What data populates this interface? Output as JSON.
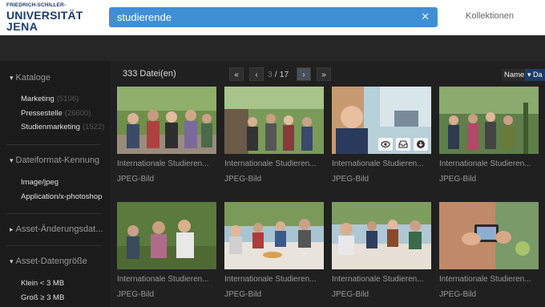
{
  "header": {
    "logo_line1": "FRIEDRICH-SCHILLER-",
    "logo_line2": "UNIVERSITÄT",
    "logo_line3": "JENA",
    "search_value": "studierende",
    "collections_label": "Kollektionen"
  },
  "sidebar": {
    "sections": [
      {
        "title": "Kataloge",
        "expanded": true,
        "items": [
          {
            "label": "Marketing",
            "count": "(5106)"
          },
          {
            "label": "Pressestelle",
            "count": "(26600)"
          },
          {
            "label": "Studienmarketing",
            "count": "(1522)"
          }
        ]
      },
      {
        "title": "Dateiformat-Kennung",
        "expanded": true,
        "items": [
          {
            "label": "Image/jpeg",
            "count": ""
          },
          {
            "label": "Application/x-photoshop",
            "count": ""
          }
        ]
      },
      {
        "title": "Asset-Änderungsdat...",
        "expanded": false,
        "items": []
      },
      {
        "title": "Asset-Datengröße",
        "expanded": true,
        "items": [
          {
            "label": "Klein < 3 MB",
            "count": ""
          },
          {
            "label": "Groß ≥ 3 MB",
            "count": ""
          }
        ]
      }
    ]
  },
  "results": {
    "count_label": "333 Datei(en)",
    "page_current": "3",
    "page_total": "/ 17",
    "sort_label": "Name",
    "sort_value": "Da"
  },
  "assets": [
    {
      "title": "Internationale Studieren...",
      "type": "JPEG-Bild"
    },
    {
      "title": "Internationale Studieren...",
      "type": "JPEG-Bild"
    },
    {
      "title": "Internationale Studieren...",
      "type": "JPEG-Bild",
      "hovered": true
    },
    {
      "title": "Internationale Studieren...",
      "type": "JPEG-Bild"
    },
    {
      "title": "Internationale Studieren...",
      "type": "JPEG-Bild"
    },
    {
      "title": "Internationale Studieren...",
      "type": "JPEG-Bild"
    },
    {
      "title": "Internationale Studieren...",
      "type": "JPEG-Bild"
    },
    {
      "title": "Internationale Studieren...",
      "type": "JPEG-Bild"
    }
  ],
  "colors": {
    "search_bg": "#3f8fd4",
    "logo": "#1d3c6e",
    "sort_select": "#1e3c6a"
  }
}
